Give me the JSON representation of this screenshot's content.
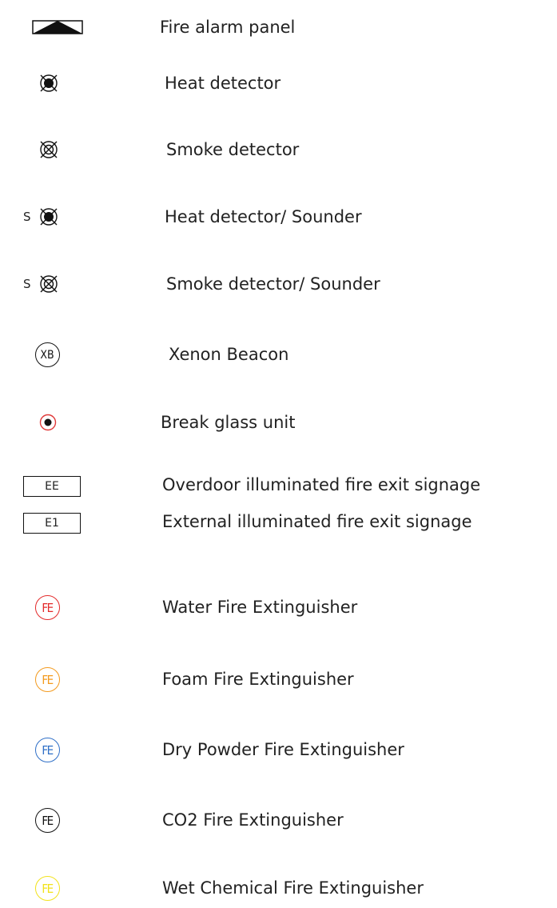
{
  "legend": {
    "items": [
      {
        "symbol": "fire-alarm-panel",
        "label": "Fire alarm panel"
      },
      {
        "symbol": "heat-detector",
        "label": "Heat detector"
      },
      {
        "symbol": "smoke-detector",
        "label": "Smoke detector"
      },
      {
        "symbol": "heat-detector-sounder",
        "prefix": "S",
        "label": "Heat detector/ Sounder"
      },
      {
        "symbol": "smoke-detector-sounder",
        "prefix": "S",
        "label": "Smoke detector/ Sounder"
      },
      {
        "symbol": "xenon-beacon",
        "text": "XB",
        "label": "Xenon Beacon"
      },
      {
        "symbol": "break-glass-unit",
        "label": "Break glass unit",
        "color": "#e03a3a"
      },
      {
        "symbol": "sign-box",
        "text": "EE",
        "label": "Overdoor illuminated fire exit signage"
      },
      {
        "symbol": "sign-box",
        "text": "E1",
        "label": "External illuminated fire exit signage"
      },
      {
        "symbol": "fire-extinguisher",
        "text": "FE",
        "label": "Water Fire Extinguisher",
        "color": "#e32a2a"
      },
      {
        "symbol": "fire-extinguisher",
        "text": "FE",
        "label": "Foam Fire Extinguisher",
        "color": "#f39a1e"
      },
      {
        "symbol": "fire-extinguisher",
        "text": "FE",
        "label": "Dry Powder Fire Extinguisher",
        "color": "#2f6fc7"
      },
      {
        "symbol": "fire-extinguisher",
        "text": "FE",
        "label": "CO2 Fire Extinguisher",
        "color": "#111111"
      },
      {
        "symbol": "fire-extinguisher",
        "text": "FE",
        "label": "Wet Chemical Fire Extinguisher",
        "color": "#f2e21a"
      }
    ]
  }
}
